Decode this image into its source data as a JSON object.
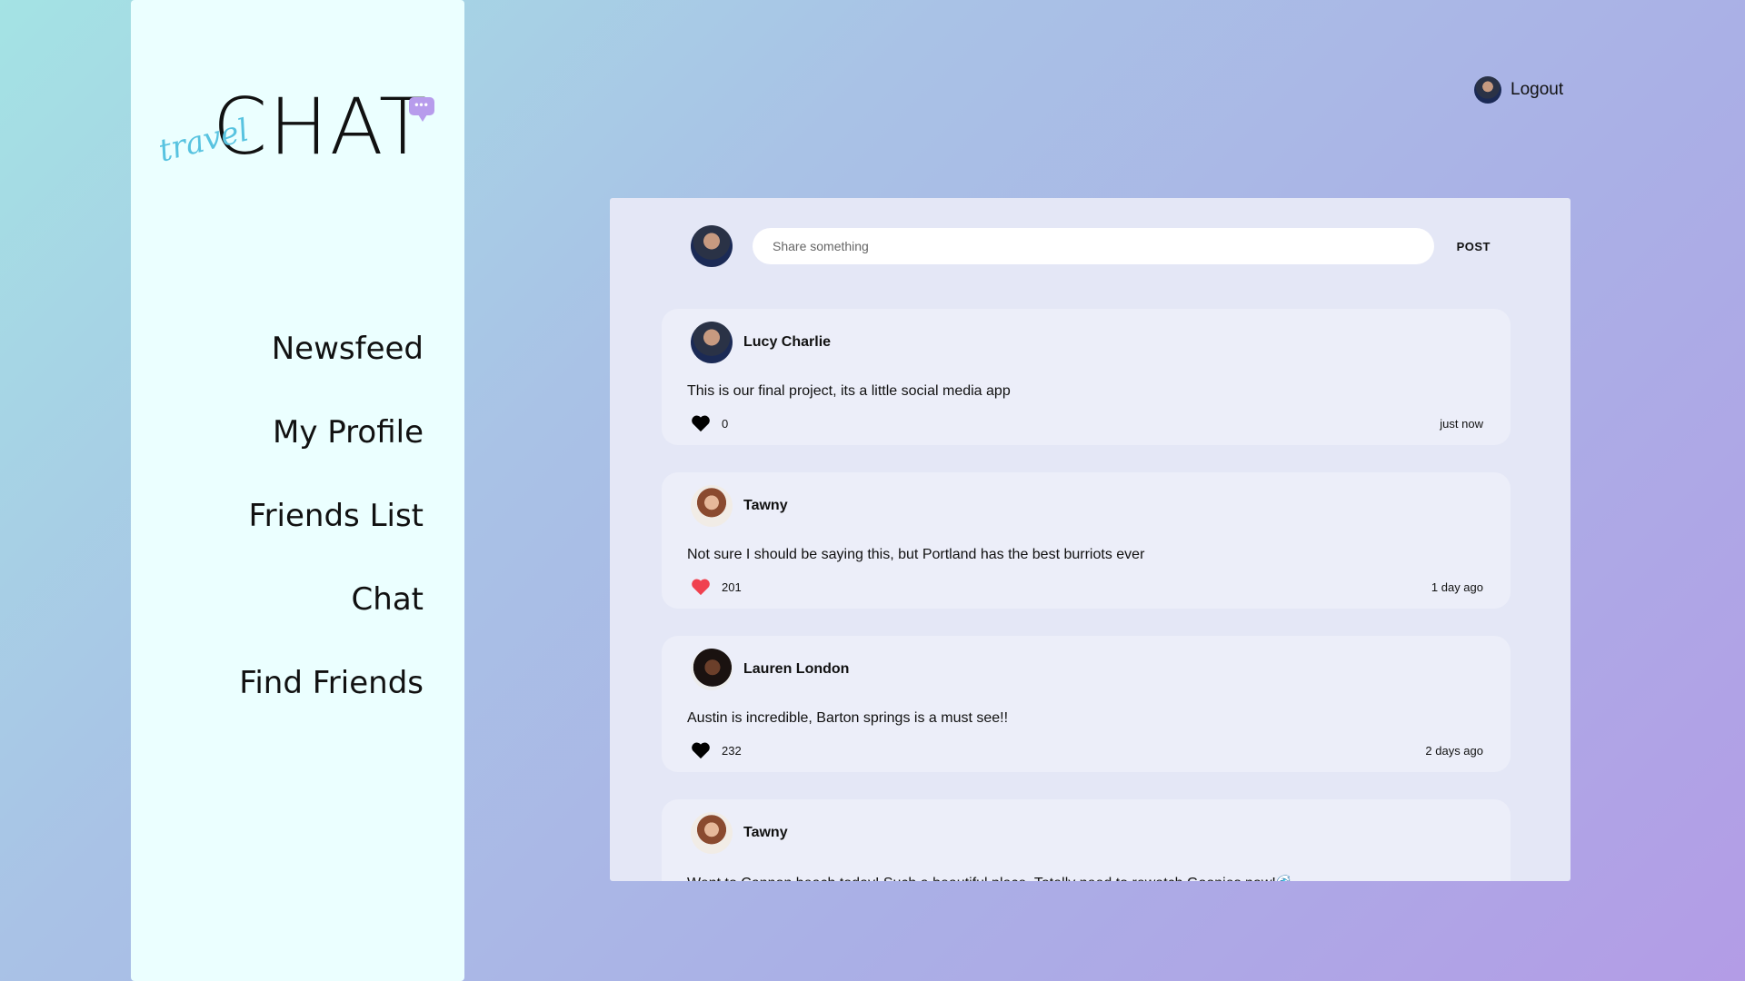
{
  "logo": {
    "main": "CHAT",
    "script": "travel",
    "bubble": "•••"
  },
  "nav": {
    "items": [
      {
        "label": "Newsfeed"
      },
      {
        "label": "My Profile"
      },
      {
        "label": "Friends List"
      },
      {
        "label": "Chat"
      },
      {
        "label": "Find Friends"
      }
    ]
  },
  "header": {
    "logout_label": "Logout"
  },
  "composer": {
    "placeholder": "Share something",
    "post_label": "POST"
  },
  "posts": [
    {
      "author": "Lucy Charlie",
      "text": "This is our final project, its a little social media app",
      "likes": "0",
      "liked": false,
      "time": "just now"
    },
    {
      "author": "Tawny",
      "text": "Not sure I should be saying this, but Portland has the best burriots ever",
      "likes": "201",
      "liked": true,
      "time": "1 day ago"
    },
    {
      "author": "Lauren London",
      "text": "Austin is incredible, Barton springs is a must see!!",
      "likes": "232",
      "liked": false,
      "time": "2 days ago"
    },
    {
      "author": "Tawny",
      "text": "Went to Cannon beach today! Such a beautiful place. Totally need to rewatch Goonies now!🌊",
      "likes": "",
      "liked": false,
      "time": ""
    }
  ],
  "colors": {
    "heart_liked": "#f0414f",
    "heart_default": "#000000",
    "accent_bubble": "#b79cec",
    "logo_script": "#58c3e0"
  }
}
